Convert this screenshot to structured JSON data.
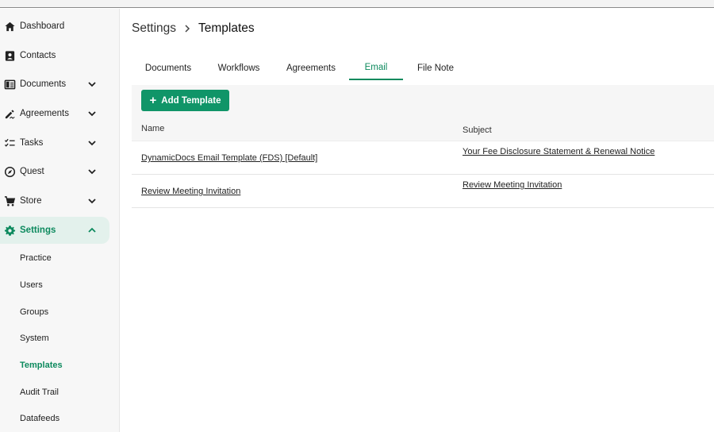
{
  "sidebar": {
    "items": [
      {
        "label": "Dashboard",
        "icon": "home-icon"
      },
      {
        "label": "Contacts",
        "icon": "contact-card-icon"
      },
      {
        "label": "Documents",
        "icon": "document-icon"
      },
      {
        "label": "Agreements",
        "icon": "signature-icon"
      },
      {
        "label": "Tasks",
        "icon": "checklist-icon"
      },
      {
        "label": "Quest",
        "icon": "compass-icon"
      },
      {
        "label": "Store",
        "icon": "cart-icon"
      },
      {
        "label": "Settings",
        "icon": "gear-icon"
      }
    ],
    "settings_sub": [
      "Practice",
      "Users",
      "Groups",
      "System",
      "Templates",
      "Audit Trail",
      "Datafeeds"
    ]
  },
  "breadcrumb": {
    "parent": "Settings",
    "current": "Templates"
  },
  "tabs": [
    "Documents",
    "Workflows",
    "Agreements",
    "Email",
    "File Note"
  ],
  "active_tab": "Email",
  "toolbar": {
    "add_label": "Add Template"
  },
  "table": {
    "headers": {
      "name": "Name",
      "subject": "Subject"
    },
    "rows": [
      {
        "name": "DynamicDocs Email Template (FDS) [Default]",
        "subject": "Your Fee Disclosure Statement & Renewal Notice"
      },
      {
        "name": "Review Meeting Invitation",
        "subject": "Review Meeting Invitation"
      }
    ]
  },
  "colors": {
    "accent": "#0d8a5e",
    "button": "#109568",
    "active_bg": "#e3f1ec"
  }
}
